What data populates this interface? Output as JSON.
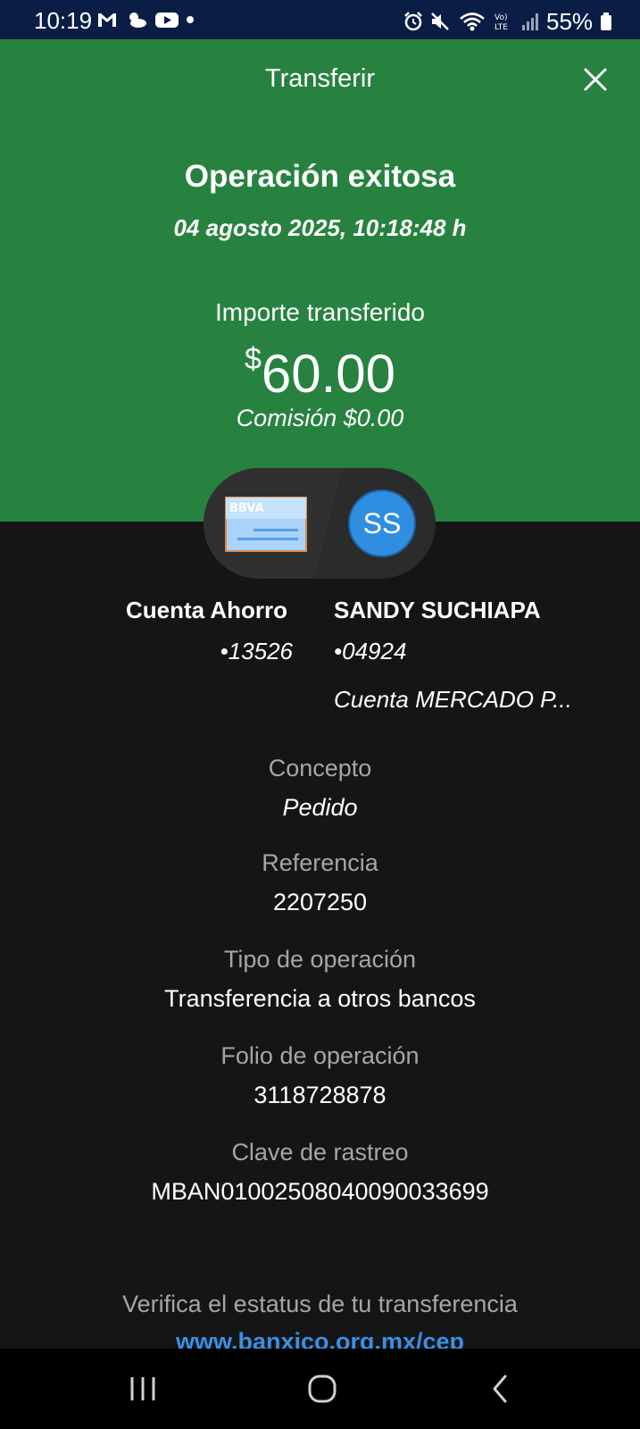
{
  "status_bar": {
    "time": "10:19",
    "battery": "55%",
    "left_icons": [
      "gmail-icon",
      "weather-icon",
      "youtube-icon",
      "dot-icon"
    ],
    "right_icons": [
      "alarm-icon",
      "mute-icon",
      "wifi-icon",
      "volte-icon",
      "signal-icon",
      "battery-icon"
    ]
  },
  "header": {
    "title": "Transferir",
    "close_icon": "close-icon",
    "background": "#278240"
  },
  "result": {
    "title": "Operación exitosa",
    "datetime": "04 agosto 2025, 10:18:48 h",
    "amount_label": "Importe transferido",
    "currency": "$",
    "amount": "60.00",
    "commission": "Comisión  $0.00"
  },
  "transfer": {
    "from": {
      "icon": "bbva-card-icon",
      "card_label": "BBVA",
      "name": "Cuenta Ahorro",
      "account": "•13526"
    },
    "to": {
      "initials": "SS",
      "name": "SANDY SUCHIAPA",
      "account": "•04924",
      "bank": "Cuenta MERCADO P..."
    }
  },
  "details": [
    {
      "label": "Concepto",
      "value": "Pedido"
    },
    {
      "label": "Referencia",
      "value": "2207250"
    },
    {
      "label": "Tipo de operación",
      "value": "Transferencia a otros bancos"
    },
    {
      "label": "Folio de operación",
      "value": "3118728878"
    },
    {
      "label": "Clave de rastreo",
      "value": "MBAN01002508040090033699"
    }
  ],
  "footer": {
    "verify_text": "Verifica el estatus de tu transferencia",
    "link": "www.banxico.org.mx/cep"
  },
  "nav_bar": {
    "buttons": [
      "recents-icon",
      "home-icon",
      "back-icon"
    ]
  }
}
